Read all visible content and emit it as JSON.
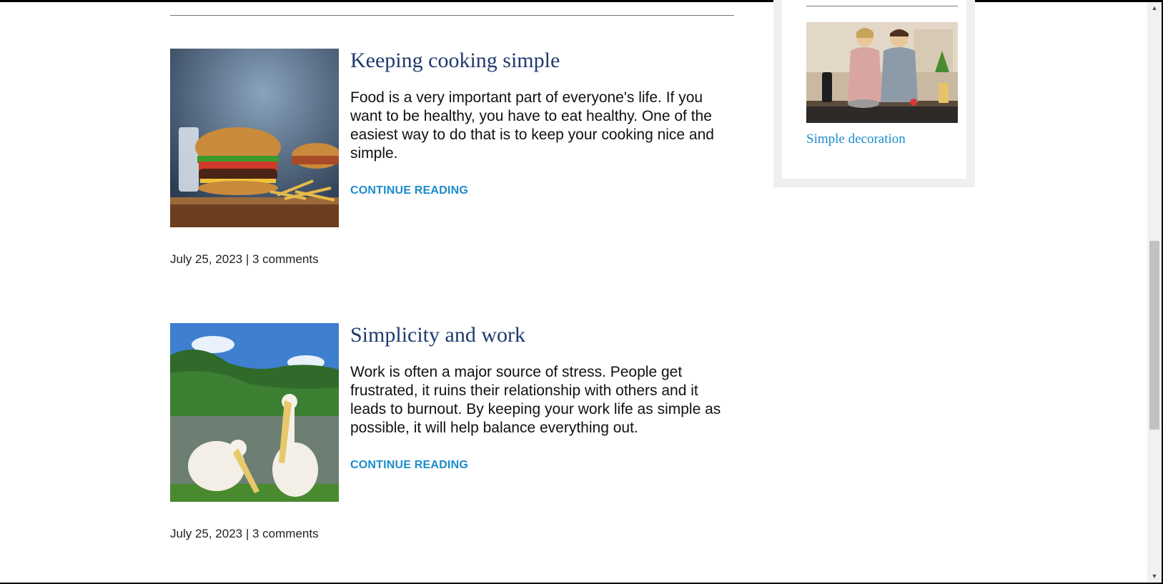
{
  "posts": [
    {
      "title": "Keeping cooking simple",
      "excerpt": "Food is a very important part of everyone's life. If you want to be healthy, you have to eat healthy. One of the easiest way to do that is to keep your cooking nice and simple.",
      "cta": "CONTINUE READING",
      "meta": "July 25, 2023 | 3 comments"
    },
    {
      "title": "Simplicity and work",
      "excerpt": "Work is often a major source of stress. People get frustrated, it ruins their relationship with others and it leads to burnout. By keeping your work life as simple as possible, it will help balance everything out.",
      "cta": "CONTINUE READING",
      "meta": "July 25, 2023 | 3 comments"
    }
  ],
  "sidebar": {
    "link": "Simple decoration"
  },
  "colors": {
    "title": "#1f3a6e",
    "link": "#1a8ccc",
    "widget_bg": "#efefef"
  }
}
